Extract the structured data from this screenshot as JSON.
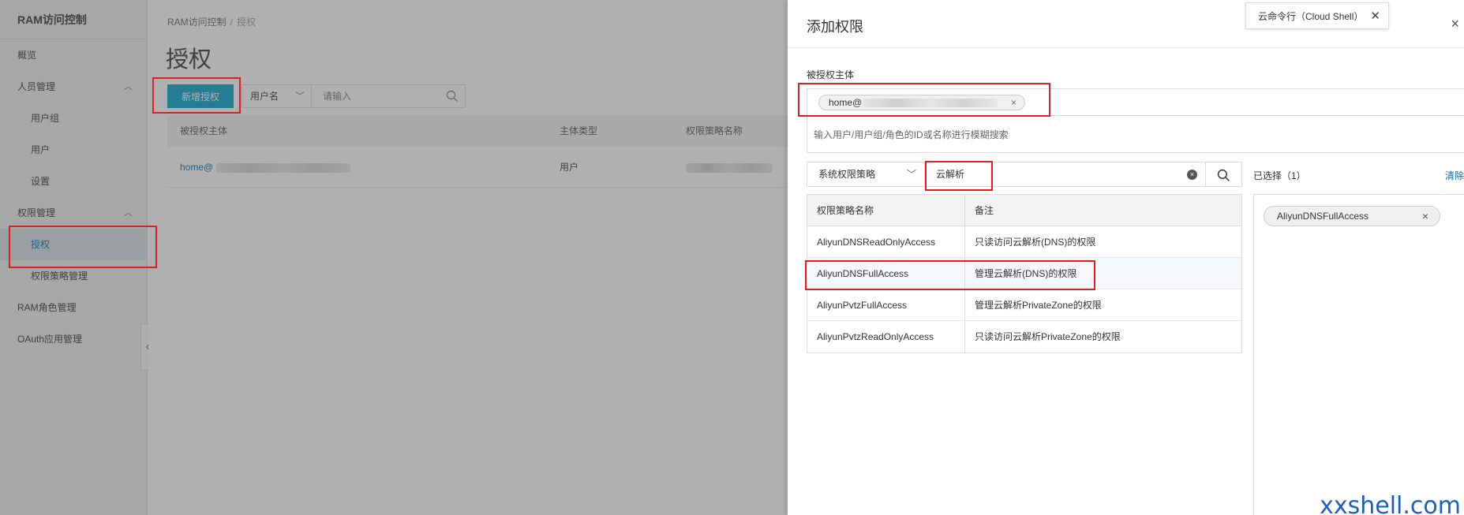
{
  "sidebar": {
    "brand": "RAM访问控制",
    "items": [
      {
        "label": "概览",
        "level": 1
      },
      {
        "label": "人员管理",
        "level": 1,
        "expand": "︿"
      },
      {
        "label": "用户组",
        "level": 2
      },
      {
        "label": "用户",
        "level": 2
      },
      {
        "label": "设置",
        "level": 2
      },
      {
        "label": "权限管理",
        "level": 1,
        "expand": "︿"
      },
      {
        "label": "授权",
        "level": 2,
        "active": true
      },
      {
        "label": "权限策略管理",
        "level": 2
      },
      {
        "label": "RAM角色管理",
        "level": 1
      },
      {
        "label": "OAuth应用管理",
        "level": 1
      }
    ],
    "collapse_icon": "«"
  },
  "main": {
    "breadcrumb": {
      "root": "RAM访问控制",
      "sep": "/",
      "current": "授权"
    },
    "title": "授权",
    "toolbar": {
      "add_button": "新增授权",
      "filter_select": "用户名",
      "search_placeholder": "请输入"
    },
    "table": {
      "headers": [
        "被授权主体",
        "主体类型",
        "权限策略名称"
      ],
      "rows": [
        {
          "principal": "home@",
          "type": "用户"
        }
      ]
    }
  },
  "drawer": {
    "title": "添加权限",
    "close": "×",
    "principal_label": "被授权主体",
    "principal_tag": "home@",
    "principal_tag_remove": "×",
    "principal_hint": "输入用户/用户组/角色的ID或名称进行模糊搜索",
    "policy_type": "系统权限策略",
    "policy_search_value": "云解析",
    "policy_search_clear": "×",
    "policy_table": {
      "headers": [
        "权限策略名称",
        "备注"
      ],
      "rows": [
        {
          "name": "AliyunDNSReadOnlyAccess",
          "note": "只读访问云解析(DNS)的权限"
        },
        {
          "name": "AliyunDNSFullAccess",
          "note": "管理云解析(DNS)的权限",
          "selected": true
        },
        {
          "name": "AliyunPvtzFullAccess",
          "note": "管理云解析PrivateZone的权限"
        },
        {
          "name": "AliyunPvtzReadOnlyAccess",
          "note": "只读访问云解析PrivateZone的权限"
        }
      ]
    },
    "selected_label": "已选择（1）",
    "clear_label": "清除",
    "selected_items": [
      {
        "name": "AliyunDNSFullAccess",
        "remove": "×"
      }
    ]
  },
  "cloud_shell": {
    "label": "云命令行（Cloud Shell）",
    "close": "✕"
  },
  "watermark": "xxshell.com",
  "colors": {
    "primary": "#00a2ca",
    "link": "#0a6ea8",
    "highlight": "#e02020"
  }
}
